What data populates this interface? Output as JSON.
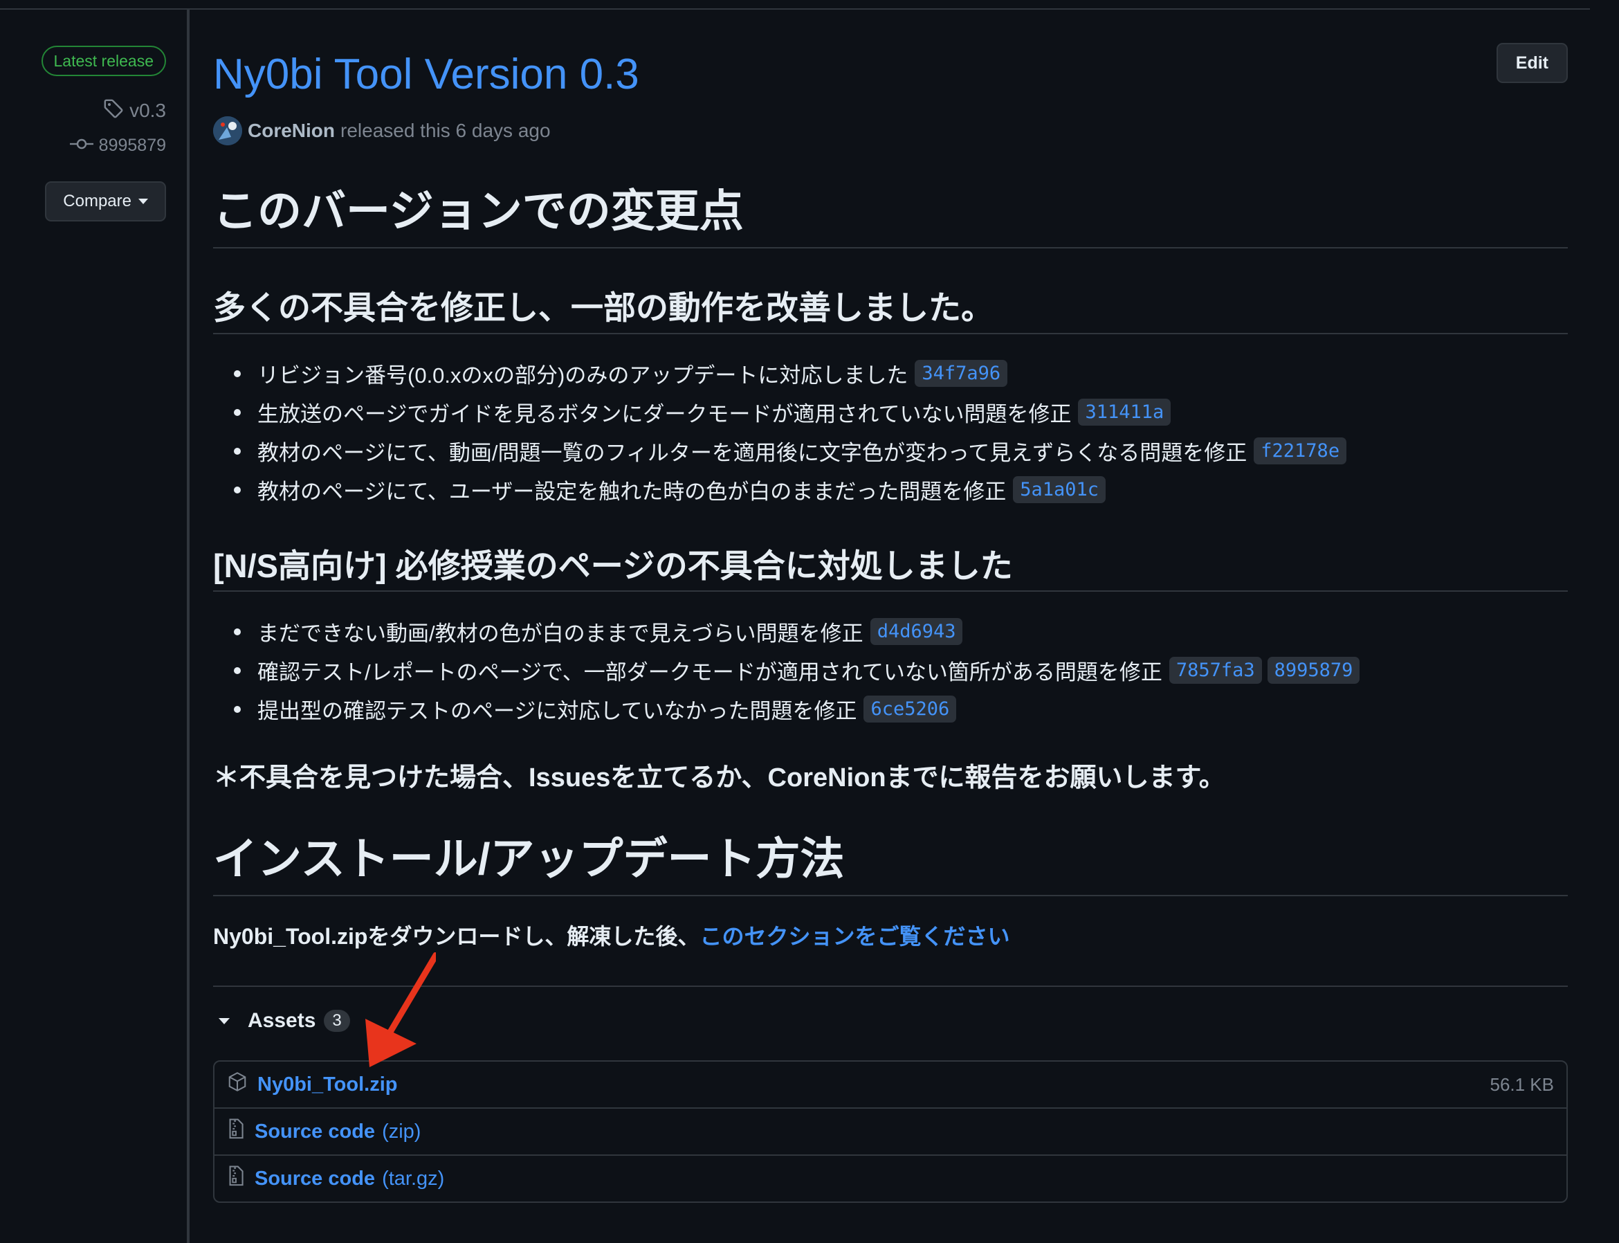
{
  "sidebar": {
    "latest_label": "Latest release",
    "tag": "v0.3",
    "commit": "8995879",
    "compare_label": "Compare"
  },
  "release": {
    "title": "Ny0bi Tool Version 0.3",
    "edit_label": "Edit",
    "author": "CoreNion",
    "released_text": "released this 6 days ago"
  },
  "content": {
    "heading_changes": "このバージョンでの変更点",
    "section1_heading": "多くの不具合を修正し、一部の動作を改善しました。",
    "section1_items": [
      {
        "text": "リビジョン番号(0.0.xのxの部分)のみのアップデートに対応しました",
        "sha": "34f7a96"
      },
      {
        "text": "生放送のページでガイドを見るボタンにダークモードが適用されていない問題を修正",
        "sha": "311411a"
      },
      {
        "text": "教材のページにて、動画/問題一覧のフィルターを適用後に文字色が変わって見えずらくなる問題を修正",
        "sha": "f22178e"
      },
      {
        "text": "教材のページにて、ユーザー設定を触れた時の色が白のままだった問題を修正",
        "sha": "5a1a01c"
      }
    ],
    "section2_heading": "[N/S高向け] 必修授業のページの不具合に対処しました",
    "section2_items": [
      {
        "text": "まだできない動画/教材の色が白のままで見えづらい問題を修正",
        "sha": "d4d6943"
      },
      {
        "text": "確認テスト/レポートのページで、一部ダークモードが適用されていない箇所がある問題を修正",
        "sha": "7857fa3",
        "sha2": "8995879"
      },
      {
        "text": "提出型の確認テストのページに対応していなかった問題を修正",
        "sha": "6ce5206"
      }
    ],
    "note": "＊不具合を見つけた場合、Issuesを立てるか、CoreNionまでに報告をお願いします。",
    "heading_install": "インストール/アップデート方法",
    "install_text": "Ny0bi_Tool.zipをダウンロードし、解凍した後、",
    "install_link": "このセクションをご覧ください"
  },
  "assets": {
    "label": "Assets",
    "count": "3",
    "items": [
      {
        "name": "Ny0bi_Tool.zip",
        "ext": "",
        "size": "56.1 KB",
        "icon": "package-icon"
      },
      {
        "name": "Source code",
        "ext": "(zip)",
        "size": "",
        "icon": "file-zip-icon"
      },
      {
        "name": "Source code",
        "ext": "(tar.gz)",
        "size": "",
        "icon": "file-zip-icon"
      }
    ]
  },
  "colors": {
    "background": "#0d1117",
    "link": "#4493f8",
    "success": "#3fb950",
    "annotation_arrow": "#e8341c"
  }
}
